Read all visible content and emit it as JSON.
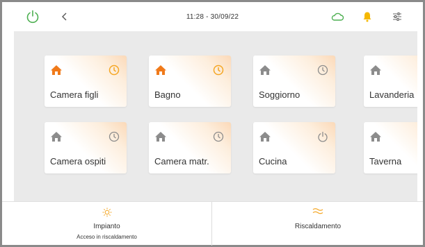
{
  "header": {
    "datetime": "11:28 - 30/09/22"
  },
  "icons": {
    "power": "power-icon",
    "back": "chevron-left-icon",
    "cloud": "cloud-icon",
    "bell": "bell-icon",
    "settings": "sliders-icon",
    "home": "home-icon",
    "clock": "clock-icon",
    "sun": "sun-icon",
    "heat": "heat-waves-icon"
  },
  "colors": {
    "accent_orange": "#f5a623",
    "home_orange": "#f07a1a",
    "icon_gray": "#8c8c8c",
    "power_green": "#4caf50",
    "cloud_green": "#4caf50",
    "bell_yellow": "#f5b800"
  },
  "rooms": [
    {
      "label": "Camera figli",
      "active": true,
      "status": "clock"
    },
    {
      "label": "Bagno",
      "active": true,
      "status": "clock"
    },
    {
      "label": "Soggiorno",
      "active": false,
      "status": "clock"
    },
    {
      "label": "Lavanderia",
      "active": false,
      "status": "none"
    },
    {
      "label": "Camera ospiti",
      "active": false,
      "status": "clock"
    },
    {
      "label": "Camera matr.",
      "active": false,
      "status": "clock"
    },
    {
      "label": "Cucina",
      "active": false,
      "status": "power"
    },
    {
      "label": "Taverna",
      "active": false,
      "status": "none"
    }
  ],
  "footer": {
    "system": {
      "title": "Impianto",
      "subtitle": "Acceso in riscaldamento"
    },
    "mode": {
      "title": "Riscaldamento"
    }
  }
}
